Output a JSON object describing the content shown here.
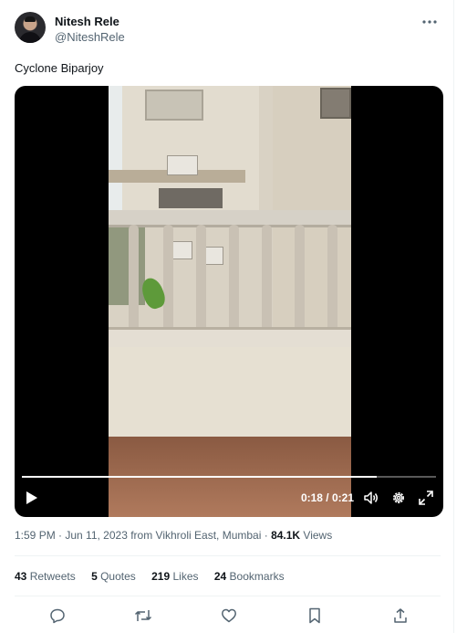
{
  "author": {
    "display_name": "Nitesh Rele",
    "handle": "@NiteshRele"
  },
  "tweet": {
    "text": "Cyclone Biparjoy"
  },
  "video": {
    "current_time": "0:18",
    "duration": "0:21",
    "time_label": "0:18 / 0:21",
    "progress_fraction": 0.857
  },
  "meta": {
    "time": "1:59 PM",
    "sep1": " · ",
    "date": "Jun 11, 2023",
    "location_text": " from Vikhroli East, Mumbai",
    "sep2": " · ",
    "views_count": "84.1K",
    "views_label": " Views"
  },
  "stats": [
    {
      "count": "43",
      "label": " Retweets"
    },
    {
      "count": "5",
      "label": " Quotes"
    },
    {
      "count": "219",
      "label": " Likes"
    },
    {
      "count": "24",
      "label": " Bookmarks"
    }
  ],
  "icons": {
    "more": "more-horizontal-icon",
    "play": "play-icon",
    "volume": "volume-icon",
    "settings": "gear-icon",
    "fullscreen": "fullscreen-icon",
    "reply": "reply-icon",
    "retweet": "retweet-icon",
    "like": "heart-icon",
    "bookmark": "bookmark-icon",
    "share": "share-icon"
  },
  "colors": {
    "text": "#0f1419",
    "secondary": "#536471",
    "divider": "#eff3f4"
  }
}
